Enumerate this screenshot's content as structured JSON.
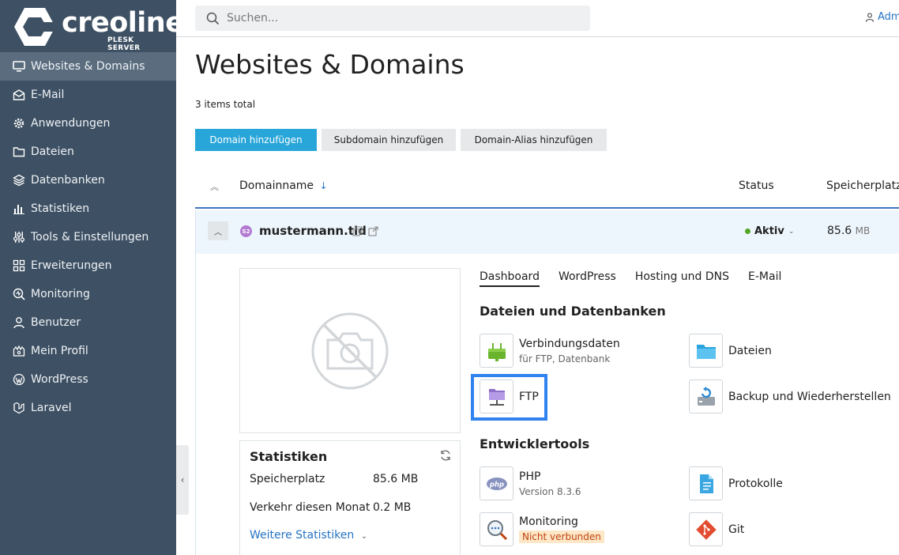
{
  "brand": {
    "name": "creoline",
    "subtitle": "PLESK SERVER"
  },
  "sidebar": {
    "items": [
      {
        "label": "Websites & Domains",
        "icon": "monitor-icon",
        "active": true
      },
      {
        "label": "E-Mail",
        "icon": "mail-icon"
      },
      {
        "label": "Anwendungen",
        "icon": "gear-icon"
      },
      {
        "label": "Dateien",
        "icon": "folder-icon"
      },
      {
        "label": "Datenbanken",
        "icon": "layers-icon"
      },
      {
        "label": "Statistiken",
        "icon": "bar-chart-icon"
      },
      {
        "label": "Tools & Einstellungen",
        "icon": "sliders-icon"
      },
      {
        "label": "Erweiterungen",
        "icon": "grid-icon"
      },
      {
        "label": "Monitoring",
        "icon": "monitoring-icon"
      },
      {
        "label": "Benutzer",
        "icon": "user-icon"
      },
      {
        "label": "Mein Profil",
        "icon": "profile-icon"
      },
      {
        "label": "WordPress",
        "icon": "wordpress-icon"
      },
      {
        "label": "Laravel",
        "icon": "laravel-icon"
      }
    ]
  },
  "header": {
    "search_placeholder": "Suchen...",
    "user_label": "Adm"
  },
  "main": {
    "title": "Websites & Domains",
    "items_total": "3 items total",
    "buttons": {
      "add_domain": "Domain hinzufügen",
      "add_subdomain": "Subdomain hinzufügen",
      "add_alias": "Domain-Alias hinzufügen"
    },
    "table": {
      "columns": {
        "domain": "Domainname",
        "status": "Status",
        "storage": "Speicherplatzb"
      },
      "sort_arrow": "↓",
      "rows": [
        {
          "favicon": "S2",
          "domain": "mustermann.tld",
          "status": "Aktiv",
          "storage_value": "85.6",
          "storage_unit": "MB"
        }
      ]
    },
    "stats": {
      "title": "Statistiken",
      "rows": [
        {
          "label": "Speicherplatz",
          "value": "85.6 MB"
        },
        {
          "label": "Verkehr diesen Monat",
          "value": "0.2 MB"
        }
      ],
      "more": "Weitere Statistiken"
    },
    "tabs": [
      "Dashboard",
      "WordPress",
      "Hosting und DNS",
      "E-Mail"
    ],
    "sections": {
      "files_db": "Dateien und Datenbanken",
      "devtools": "Entwicklertools"
    },
    "tiles": {
      "connection": {
        "title": "Verbindungsdaten",
        "sub": "für FTP, Datenbank"
      },
      "files": {
        "title": "Dateien"
      },
      "ftp": {
        "title": "FTP"
      },
      "backup": {
        "title": "Backup und Wiederherstellen"
      },
      "php": {
        "title": "PHP",
        "sub": "Version 8.3.6"
      },
      "logs": {
        "title": "Protokolle"
      },
      "monitoring": {
        "title": "Monitoring",
        "badge": "Nicht verbunden"
      },
      "git": {
        "title": "Git"
      }
    }
  },
  "colors": {
    "sidebar_bg": "#3e5063",
    "primary": "#28a5d9",
    "link": "#2673c4",
    "active_green": "#53a623",
    "highlight": "#2f82f0"
  }
}
